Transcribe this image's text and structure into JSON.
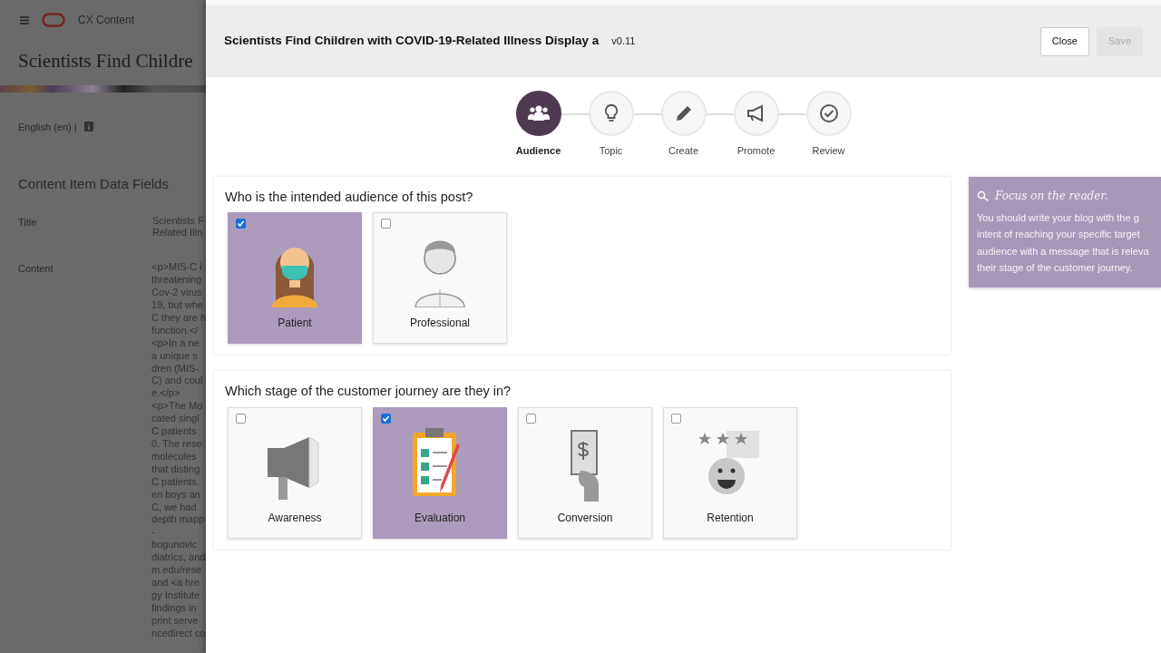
{
  "background_page": {
    "app_name": "CX Content",
    "heading": "Scientists Find Childre",
    "language": "English (en) |",
    "section_title": "Content Item Data Fields",
    "fields": [
      {
        "label": "Title",
        "lines": [
          "Scientists F",
          "Related Illn"
        ]
      },
      {
        "label": "Content",
        "lines": [
          "<p>MIS-C i",
          "threatening",
          "Cov-2 virus",
          "19, but whe",
          "C they are h",
          "function.</",
          "<p>In a ne",
          "a unique s",
          "dren (MIS-",
          "C) and coul",
          "e.</p>",
          "<p>The Mo",
          "cated singl",
          "C patients",
          "0. The rese",
          "molecules",
          "that disting",
          "C patients.",
          "en boys an",
          "C, we had",
          "depth mapp",
          "-",
          "bogunovic",
          "diatrics, and",
          "m.edu/rese",
          "and <a hre",
          "gy Institute",
          "findings in",
          "print serve",
          "ncedirect co"
        ]
      }
    ]
  },
  "dialog": {
    "title": "Scientists Find Children with COVID-19-Related Illness Display a",
    "version": "v0.11",
    "buttons": [
      {
        "label": "Close",
        "disabled": false
      },
      {
        "label": "Save",
        "disabled": true
      }
    ]
  },
  "steps": [
    {
      "label": "Audience",
      "selected": true
    },
    {
      "label": "Topic",
      "selected": false
    },
    {
      "label": "Create",
      "selected": false
    },
    {
      "label": "Promote",
      "selected": false
    },
    {
      "label": "Review",
      "selected": false
    }
  ],
  "questions": [
    {
      "question": "Who is the intended audience of this post?",
      "options": [
        {
          "label": "Patient",
          "selected": true
        },
        {
          "label": "Professional",
          "selected": false
        }
      ]
    },
    {
      "question": "Which stage of the customer journey are they in?",
      "options": [
        {
          "label": "Awareness",
          "selected": false
        },
        {
          "label": "Evaluation",
          "selected": true
        },
        {
          "label": "Conversion",
          "selected": false
        },
        {
          "label": "Retention",
          "selected": false
        }
      ]
    }
  ],
  "tip": {
    "title": "Focus on the reader.",
    "lines": [
      "You should write your blog with the g",
      "intent of reaching your specific target",
      "audience with a message that is releva",
      "their stage of the customer journey."
    ]
  }
}
